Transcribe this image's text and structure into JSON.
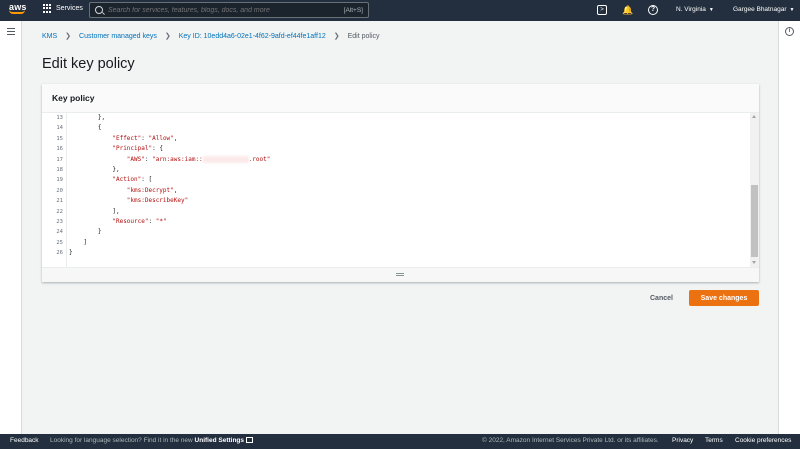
{
  "topnav": {
    "logo_text": "aws",
    "services_label": "Services",
    "search_placeholder": "Search for services, features, blogs, docs, and more",
    "search_shortcut": "[Alt+S]",
    "region": "N. Virginia",
    "user": "Gargee Bhatnagar",
    "icons": [
      "cloudshell-icon",
      "bell-icon",
      "help-icon"
    ]
  },
  "breadcrumb": {
    "items": [
      "KMS",
      "Customer managed keys",
      "Key ID: 10edd4a6-02e1-4f62-9afd-ef44fe1aff12"
    ],
    "current": "Edit policy"
  },
  "page": {
    "title": "Edit key policy"
  },
  "panel": {
    "title": "Key policy"
  },
  "editor": {
    "lines": [
      {
        "n": "13",
        "indent": "        ",
        "text": "},"
      },
      {
        "n": "14",
        "indent": "        ",
        "text": "{"
      },
      {
        "n": "15",
        "indent": "            ",
        "key": "\"Effect\"",
        "sep": ": ",
        "val": "\"Allow\"",
        "tail": ","
      },
      {
        "n": "16",
        "indent": "            ",
        "key": "\"Principal\"",
        "sep": ": {",
        "val": "",
        "tail": ""
      },
      {
        "n": "17",
        "indent": "                ",
        "key": "\"AWS\"",
        "sep": ": ",
        "val": "\"arn:aws:iam::",
        "redacted": true,
        "val2": ".root\"",
        "tail": ""
      },
      {
        "n": "18",
        "indent": "            ",
        "text": "},"
      },
      {
        "n": "19",
        "indent": "            ",
        "key": "\"Action\"",
        "sep": ": [",
        "val": "",
        "tail": ""
      },
      {
        "n": "20",
        "indent": "                ",
        "val": "\"kms:Decrypt\"",
        "tail": ","
      },
      {
        "n": "21",
        "indent": "                ",
        "val": "\"kms:DescribeKey\"",
        "tail": ""
      },
      {
        "n": "22",
        "indent": "            ",
        "text": "],"
      },
      {
        "n": "23",
        "indent": "            ",
        "key": "\"Resource\"",
        "sep": ": ",
        "val": "\"*\"",
        "tail": ""
      },
      {
        "n": "24",
        "indent": "        ",
        "text": "}"
      },
      {
        "n": "25",
        "indent": "    ",
        "text": "]"
      },
      {
        "n": "26",
        "indent": "",
        "text": "}"
      }
    ]
  },
  "actions": {
    "cancel": "Cancel",
    "save": "Save changes"
  },
  "footer": {
    "feedback": "Feedback",
    "lang_prefix": "Looking for language selection? Find it in the new ",
    "lang_link": "Unified Settings",
    "copyright": "© 2022, Amazon Internet Services Private Ltd. or its affiliates.",
    "privacy": "Privacy",
    "terms": "Terms",
    "cookies": "Cookie preferences"
  },
  "colors": {
    "nav_bg": "#232f3e",
    "primary_button": "#ec7211",
    "link": "#0073bb",
    "string": "#b30e0e"
  }
}
